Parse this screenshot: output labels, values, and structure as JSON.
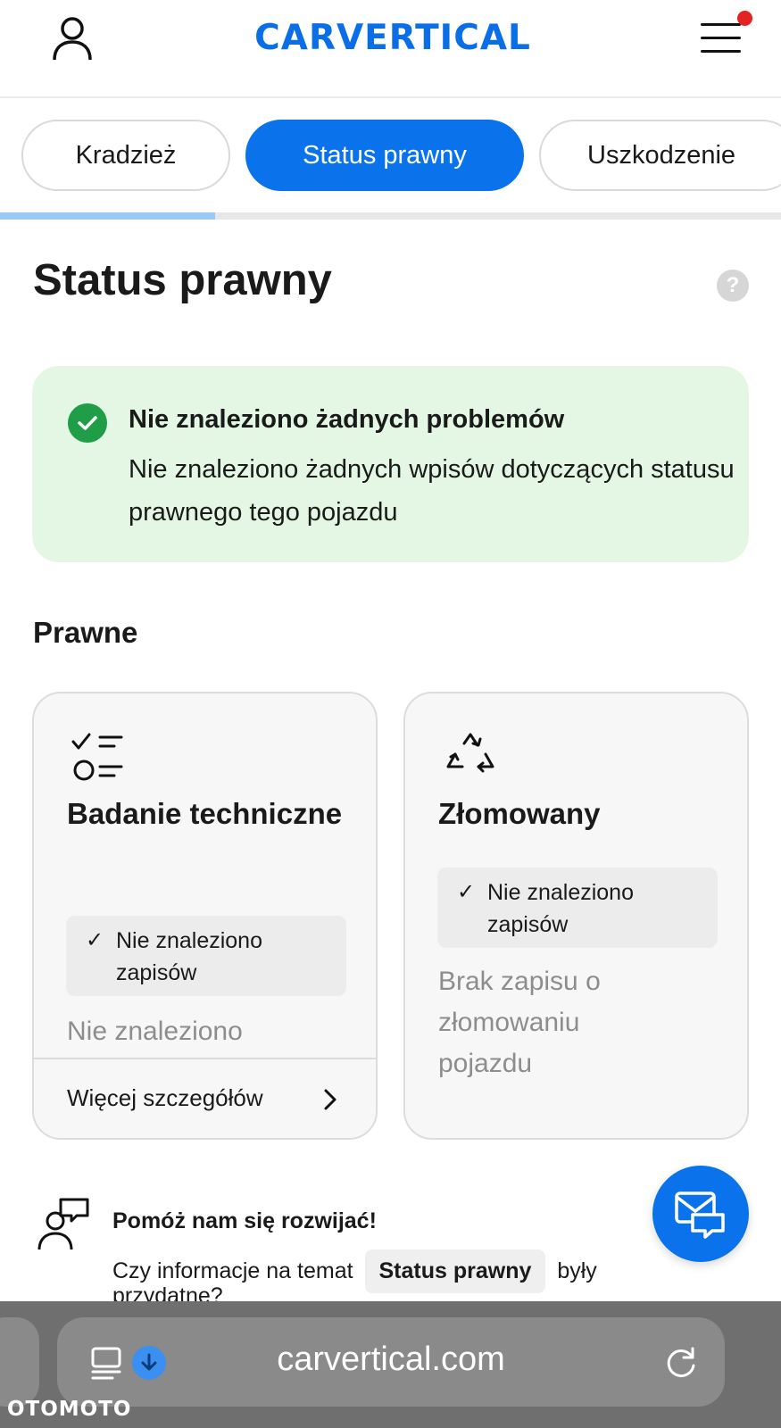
{
  "header": {
    "logo_text": "CARVERTICAL",
    "brand_color": "#0a73eb",
    "notification_dot_color": "#e52222"
  },
  "tabs": [
    {
      "label": "Kradzież",
      "active": false
    },
    {
      "label": "Status prawny",
      "active": true
    },
    {
      "label": "Uszkodzenie",
      "active": false
    }
  ],
  "tabs_progress": 0.275,
  "page_title": "Status prawny",
  "help_icon": "question-mark-icon",
  "status_box": {
    "title": "Nie znaleziono żadnych problemów",
    "text": "Nie znaleziono żadnych wpisów dotyczących statusu prawnego tego pojazdu",
    "color": "#1f9e47"
  },
  "section_title": "Prawne",
  "cards": [
    {
      "icon": "checklist-icon",
      "title": "Badanie techniczne",
      "badge": "Nie znaleziono zapisów",
      "description": "Nie znaleziono",
      "footer_link": "Więcej szczegółów"
    },
    {
      "icon": "recycle-icon",
      "title": "Złomowany",
      "badge": "Nie znaleziono zapisów",
      "description": "Brak zapisu o złomowaniu pojazdu"
    }
  ],
  "feedback": {
    "title": "Pomóż nam się rozwijać!",
    "question_before": "Czy informacje na temat",
    "topic": "Status prawny",
    "question_after": "były",
    "question_end": "przydatne?"
  },
  "browser": {
    "url": "carvertical.com"
  },
  "watermark": "OTOMOTO"
}
